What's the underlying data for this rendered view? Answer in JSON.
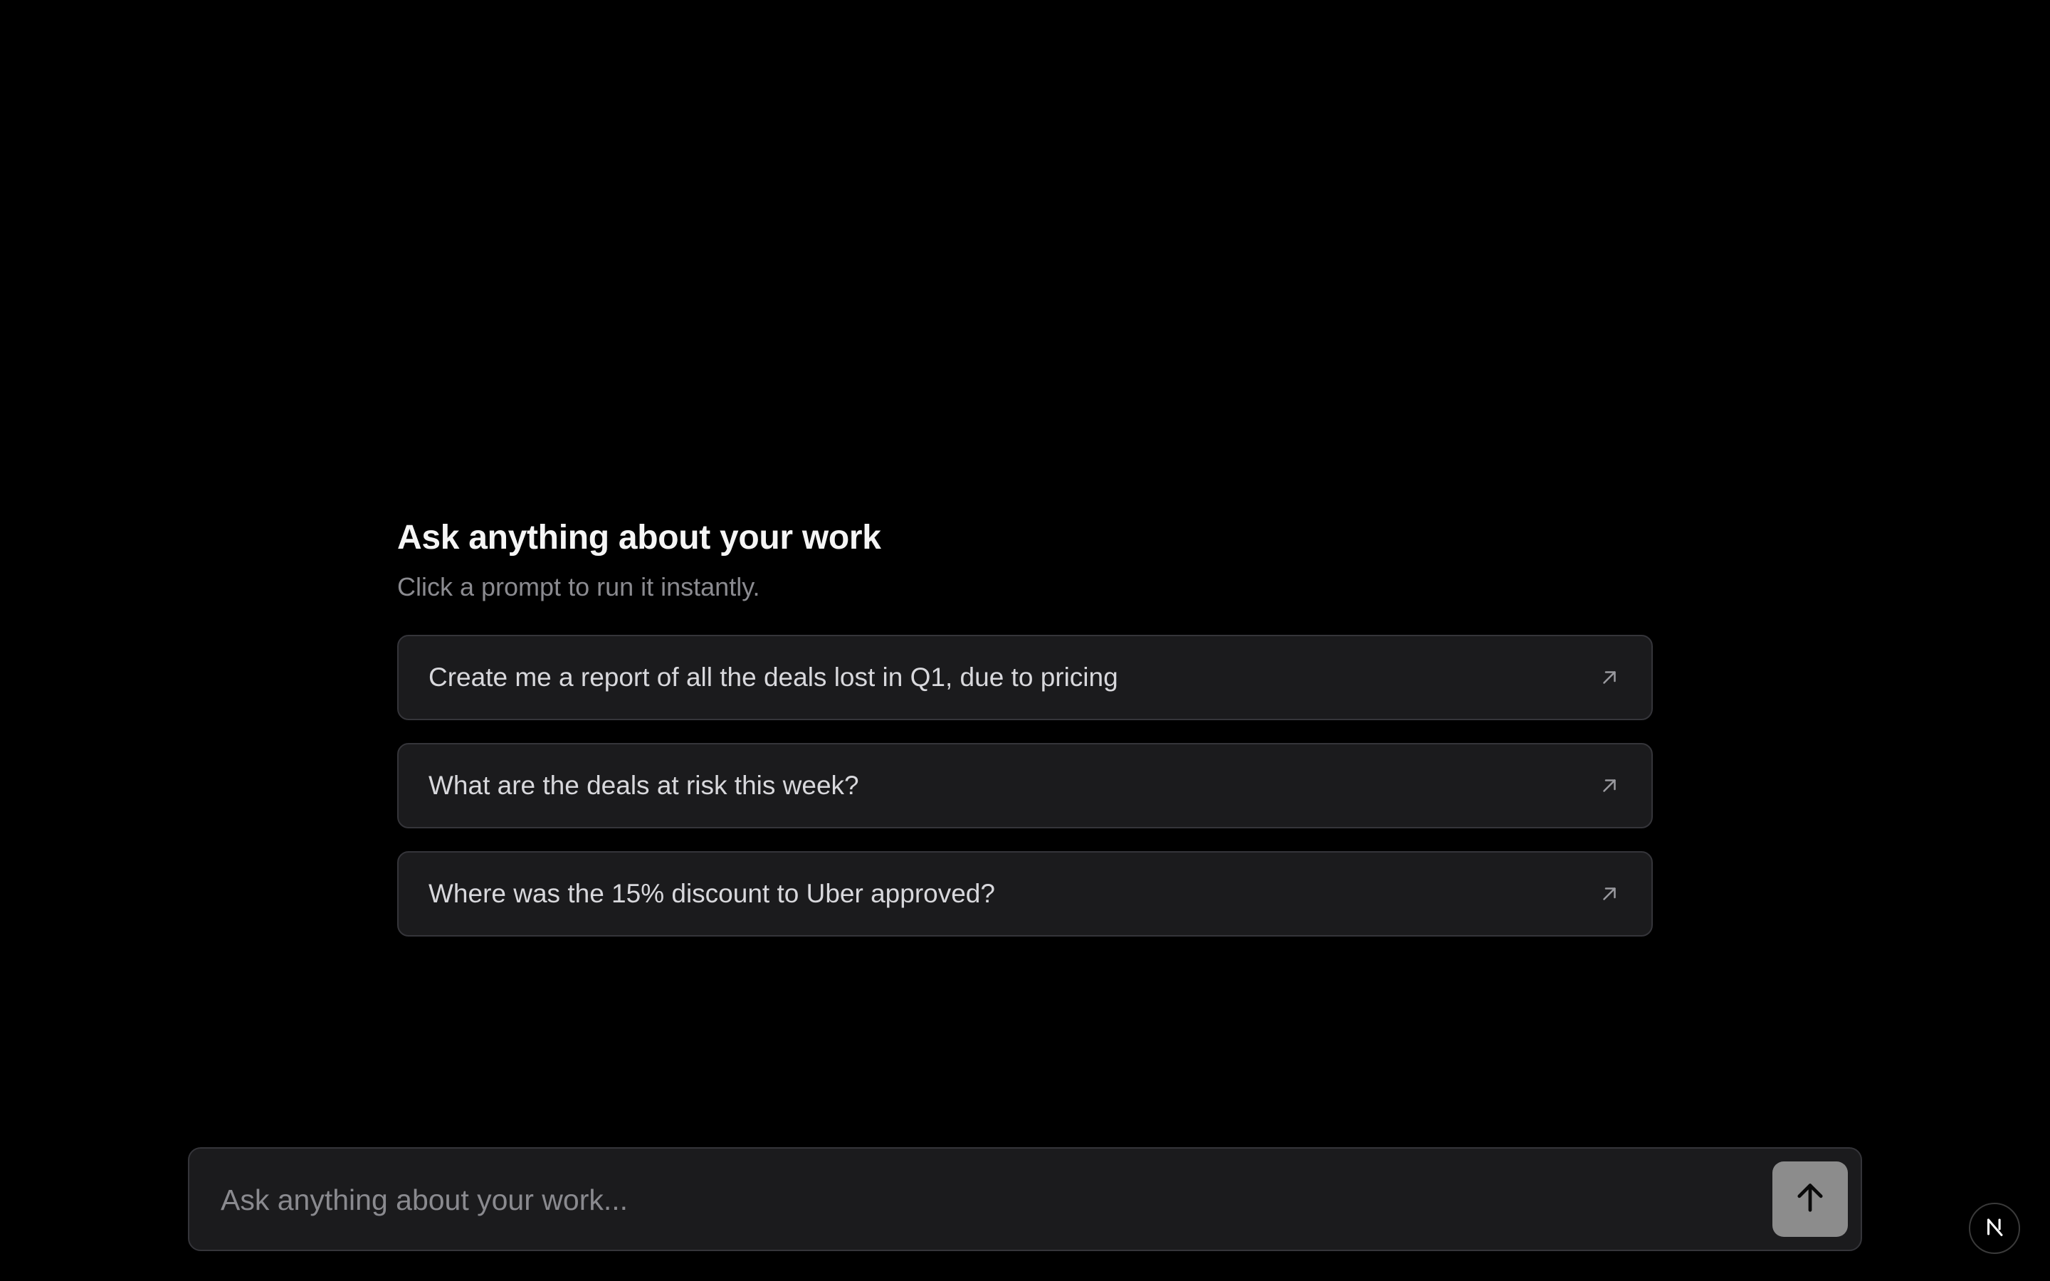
{
  "header": {
    "title": "Ask anything about your work",
    "subtitle": "Click a prompt to run it instantly."
  },
  "prompts": [
    {
      "label": "Create me a report of all the deals lost in Q1, due to pricing",
      "icon": "arrow-up-right-icon"
    },
    {
      "label": "What are the deals at risk this week?",
      "icon": "arrow-up-right-icon"
    },
    {
      "label": "Where was the 15% discount to Uber approved?",
      "icon": "arrow-up-right-icon"
    }
  ],
  "composer": {
    "placeholder": "Ask anything about your work...",
    "value": "",
    "send_icon": "arrow-up-icon"
  },
  "badge": {
    "icon": "nextjs-logo-icon"
  },
  "colors": {
    "background": "#000000",
    "card": "#1b1b1d",
    "border": "#35353a",
    "send_button": "#8c8c8c"
  }
}
